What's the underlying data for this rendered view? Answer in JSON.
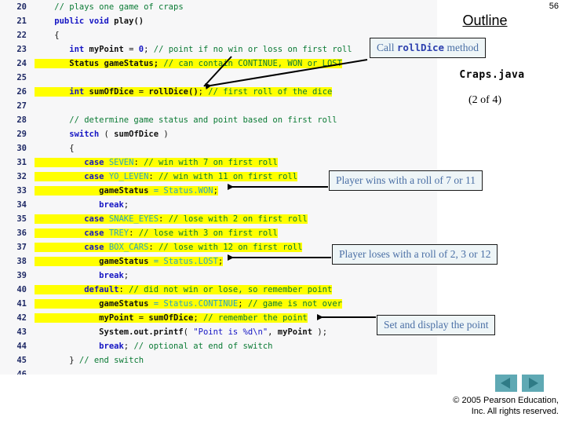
{
  "slide": {
    "page_number": "56",
    "outline_title": "Outline",
    "file_name": "Craps.java",
    "file_part": "(2 of 4)",
    "copyright_line1": "© 2005 Pearson Education,",
    "copyright_line2": "Inc.  All rights reserved."
  },
  "callouts": {
    "rolldice": {
      "pre": "Call ",
      "mono": "rollDice",
      "post": " method"
    },
    "win": "Player wins with a roll of 7 or 11",
    "lose": "Player loses with a roll of 2, 3 or 12",
    "point": "Set and display the point"
  },
  "nav": {
    "prev_label": "previous-slide",
    "next_label": "next-slide"
  },
  "colors": {
    "highlight": "#ffff00",
    "comment": "#0a7a34",
    "keyword": "#1515c4",
    "constant": "#2aa2c8",
    "callout_text": "#4a6fa5",
    "callout_bg": "#eef5f7",
    "nav_button": "#5fa9b4",
    "nav_arrow": "#2f7b86",
    "code_bg": "#f7f7f8",
    "line_number": "#1f2a66"
  },
  "code": {
    "language": "java",
    "lines": [
      {
        "n": "20",
        "hl": false,
        "tokens": [
          {
            "t": "cmt",
            "s": "    // plays one game of craps"
          }
        ]
      },
      {
        "n": "21",
        "hl": false,
        "tokens": [
          {
            "t": "kw",
            "s": "    public void "
          },
          {
            "t": "id",
            "s": "play()"
          }
        ]
      },
      {
        "n": "22",
        "hl": false,
        "tokens": [
          {
            "t": "pl",
            "s": "    {"
          }
        ]
      },
      {
        "n": "23",
        "hl": false,
        "tokens": [
          {
            "t": "kw",
            "s": "       int "
          },
          {
            "t": "id",
            "s": "myPoint"
          },
          {
            "t": "pl",
            "s": " = "
          },
          {
            "t": "num",
            "s": "0"
          },
          {
            "t": "pl",
            "s": "; "
          },
          {
            "t": "cmt",
            "s": "// point if no win or loss on first roll"
          }
        ]
      },
      {
        "n": "24",
        "hl": true,
        "tokens": [
          {
            "t": "id",
            "s": "       Status gameStatus; "
          },
          {
            "t": "cmt",
            "s": "// can contain CONTINUE, WON or LOST"
          }
        ]
      },
      {
        "n": "25",
        "hl": false,
        "tokens": [
          {
            "t": "pl",
            "s": ""
          }
        ]
      },
      {
        "n": "26",
        "hl": true,
        "tokens": [
          {
            "t": "kw",
            "s": "       int "
          },
          {
            "t": "id",
            "s": "sumOfDice"
          },
          {
            "t": "pl",
            "s": " = "
          },
          {
            "t": "id",
            "s": "rollDice()"
          },
          {
            "t": "pl",
            "s": "; "
          },
          {
            "t": "cmt",
            "s": "// first roll of the dice"
          }
        ]
      },
      {
        "n": "27",
        "hl": false,
        "tokens": [
          {
            "t": "pl",
            "s": ""
          }
        ]
      },
      {
        "n": "28",
        "hl": false,
        "tokens": [
          {
            "t": "cmt",
            "s": "       // determine game status and point based on first roll"
          }
        ]
      },
      {
        "n": "29",
        "hl": false,
        "tokens": [
          {
            "t": "kw",
            "s": "       switch "
          },
          {
            "t": "pl",
            "s": "( "
          },
          {
            "t": "id",
            "s": "sumOfDice"
          },
          {
            "t": "pl",
            "s": " )"
          }
        ]
      },
      {
        "n": "30",
        "hl": false,
        "tokens": [
          {
            "t": "pl",
            "s": "       {"
          }
        ]
      },
      {
        "n": "31",
        "hl": true,
        "tokens": [
          {
            "t": "kw",
            "s": "          case "
          },
          {
            "t": "const",
            "s": "SEVEN"
          },
          {
            "t": "pl",
            "s": ": "
          },
          {
            "t": "cmt",
            "s": "// win with 7 on first roll"
          }
        ]
      },
      {
        "n": "32",
        "hl": true,
        "tokens": [
          {
            "t": "kw",
            "s": "          case "
          },
          {
            "t": "const",
            "s": "YO_LEVEN"
          },
          {
            "t": "pl",
            "s": ": "
          },
          {
            "t": "cmt",
            "s": "// win with 11 on first roll"
          }
        ]
      },
      {
        "n": "33",
        "hl": true,
        "tokens": [
          {
            "t": "id",
            "s": "             gameStatus"
          },
          {
            "t": "op",
            "s": " = "
          },
          {
            "t": "const",
            "s": "Status.WON"
          },
          {
            "t": "pl",
            "s": ";"
          }
        ]
      },
      {
        "n": "34",
        "hl": false,
        "tokens": [
          {
            "t": "kw",
            "s": "             break"
          },
          {
            "t": "pl",
            "s": ";"
          }
        ]
      },
      {
        "n": "35",
        "hl": true,
        "tokens": [
          {
            "t": "kw",
            "s": "          case "
          },
          {
            "t": "const",
            "s": "SNAKE_EYES"
          },
          {
            "t": "pl",
            "s": ": "
          },
          {
            "t": "cmt",
            "s": "// lose with 2 on first roll"
          }
        ]
      },
      {
        "n": "36",
        "hl": true,
        "tokens": [
          {
            "t": "kw",
            "s": "          case "
          },
          {
            "t": "const",
            "s": "TREY"
          },
          {
            "t": "pl",
            "s": ": "
          },
          {
            "t": "cmt",
            "s": "// lose with 3 on first roll"
          }
        ]
      },
      {
        "n": "37",
        "hl": true,
        "tokens": [
          {
            "t": "kw",
            "s": "          case "
          },
          {
            "t": "const",
            "s": "BOX_CARS"
          },
          {
            "t": "pl",
            "s": ": "
          },
          {
            "t": "cmt",
            "s": "// lose with 12 on first roll"
          }
        ]
      },
      {
        "n": "38",
        "hl": true,
        "tokens": [
          {
            "t": "id",
            "s": "             gameStatus"
          },
          {
            "t": "op",
            "s": " = "
          },
          {
            "t": "const",
            "s": "Status.LOST"
          },
          {
            "t": "pl",
            "s": ";"
          }
        ]
      },
      {
        "n": "39",
        "hl": false,
        "tokens": [
          {
            "t": "kw",
            "s": "             break"
          },
          {
            "t": "pl",
            "s": ";"
          }
        ]
      },
      {
        "n": "40",
        "hl": true,
        "tokens": [
          {
            "t": "kw",
            "s": "          default"
          },
          {
            "t": "pl",
            "s": ": "
          },
          {
            "t": "cmt",
            "s": "// did not win or lose, so remember point"
          }
        ]
      },
      {
        "n": "41",
        "hl": true,
        "tokens": [
          {
            "t": "id",
            "s": "             gameStatus"
          },
          {
            "t": "op",
            "s": " = "
          },
          {
            "t": "const",
            "s": "Status.CONTINUE"
          },
          {
            "t": "pl",
            "s": "; "
          },
          {
            "t": "cmt",
            "s": "// game is not over"
          }
        ]
      },
      {
        "n": "42",
        "hl": true,
        "tokens": [
          {
            "t": "id",
            "s": "             myPoint"
          },
          {
            "t": "pl",
            "s": " = "
          },
          {
            "t": "id",
            "s": "sumOfDice"
          },
          {
            "t": "pl",
            "s": "; "
          },
          {
            "t": "cmt",
            "s": "// remember the point"
          }
        ]
      },
      {
        "n": "43",
        "hl": false,
        "tokens": [
          {
            "t": "id",
            "s": "             System.out.printf"
          },
          {
            "t": "pl",
            "s": "( "
          },
          {
            "t": "str",
            "s": "\"Point is %d\\n\""
          },
          {
            "t": "pl",
            "s": ", "
          },
          {
            "t": "id",
            "s": "myPoint"
          },
          {
            "t": "pl",
            "s": " );"
          }
        ]
      },
      {
        "n": "44",
        "hl": false,
        "tokens": [
          {
            "t": "kw",
            "s": "             break"
          },
          {
            "t": "pl",
            "s": "; "
          },
          {
            "t": "cmt",
            "s": "// optional at end of switch"
          }
        ]
      },
      {
        "n": "45",
        "hl": false,
        "tokens": [
          {
            "t": "pl",
            "s": "       } "
          },
          {
            "t": "cmt",
            "s": "// end switch"
          }
        ]
      },
      {
        "n": "46",
        "hl": false,
        "tokens": [
          {
            "t": "pl",
            "s": ""
          }
        ]
      }
    ]
  }
}
